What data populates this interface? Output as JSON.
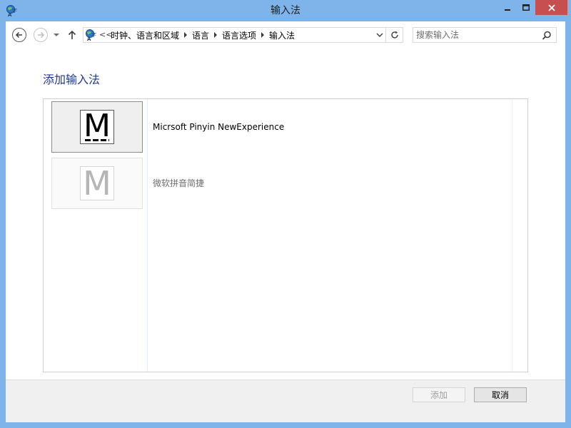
{
  "window": {
    "title": "输入法",
    "app_icon": "language-globe-icon"
  },
  "nav": {
    "back_icon": "back-arrow-icon",
    "forward_icon": "forward-arrow-icon",
    "up_icon": "up-arrow-icon",
    "overflow": "<<",
    "breadcrumbs": [
      {
        "label": "时钟、语言和区域"
      },
      {
        "label": "语言"
      },
      {
        "label": "语言选项"
      },
      {
        "label": "输入法"
      }
    ]
  },
  "search": {
    "placeholder": "搜索输入法",
    "value": ""
  },
  "main": {
    "heading": "添加输入法",
    "items": [
      {
        "glyph": "M",
        "name": "Micrsoft Pinyin NewExperience",
        "selected": true
      },
      {
        "glyph": "M",
        "name": "微软拼音简捷",
        "selected": false
      }
    ]
  },
  "footer": {
    "add_label": "添加",
    "add_enabled": false,
    "cancel_label": "取消"
  },
  "colors": {
    "titlebar": "#7eb4ea",
    "close_button": "#c74f4f",
    "heading": "#1e3a8f"
  }
}
